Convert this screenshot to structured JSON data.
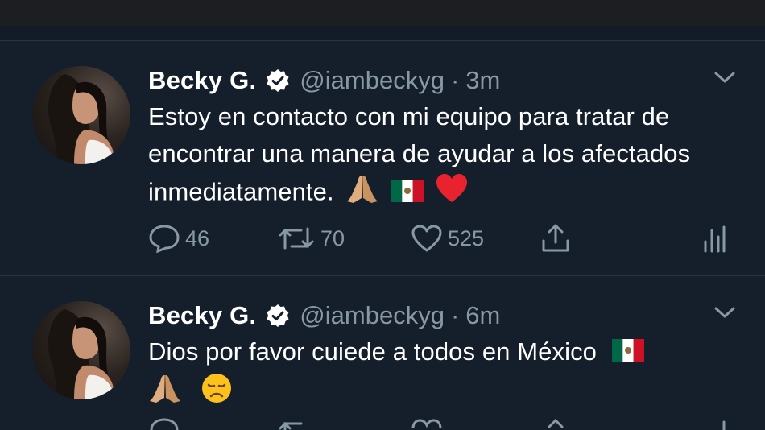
{
  "tweets": [
    {
      "name": "Becky G.",
      "handle": "@iambeckyg",
      "separator": "·",
      "time": "3m",
      "text": "Estoy en contacto con mi equipo para tratar de encontrar una manera de ayudar a los afectados inmediatamente.",
      "emojis": [
        "folded-hands",
        "flag-mexico",
        "red-heart"
      ],
      "replies": "46",
      "retweets": "70",
      "likes": "525"
    },
    {
      "name": "Becky G.",
      "handle": "@iambeckyg",
      "separator": "·",
      "time": "6m",
      "text": "Dios por favor cuiede a todos en México",
      "emojis": [
        "flag-mexico",
        "folded-hands",
        "disappointed-face"
      ]
    }
  ],
  "colors": {
    "background": "#151e2b",
    "secondary_text": "#8899a6",
    "divider": "#2a3441",
    "heart": "#e0245e"
  }
}
